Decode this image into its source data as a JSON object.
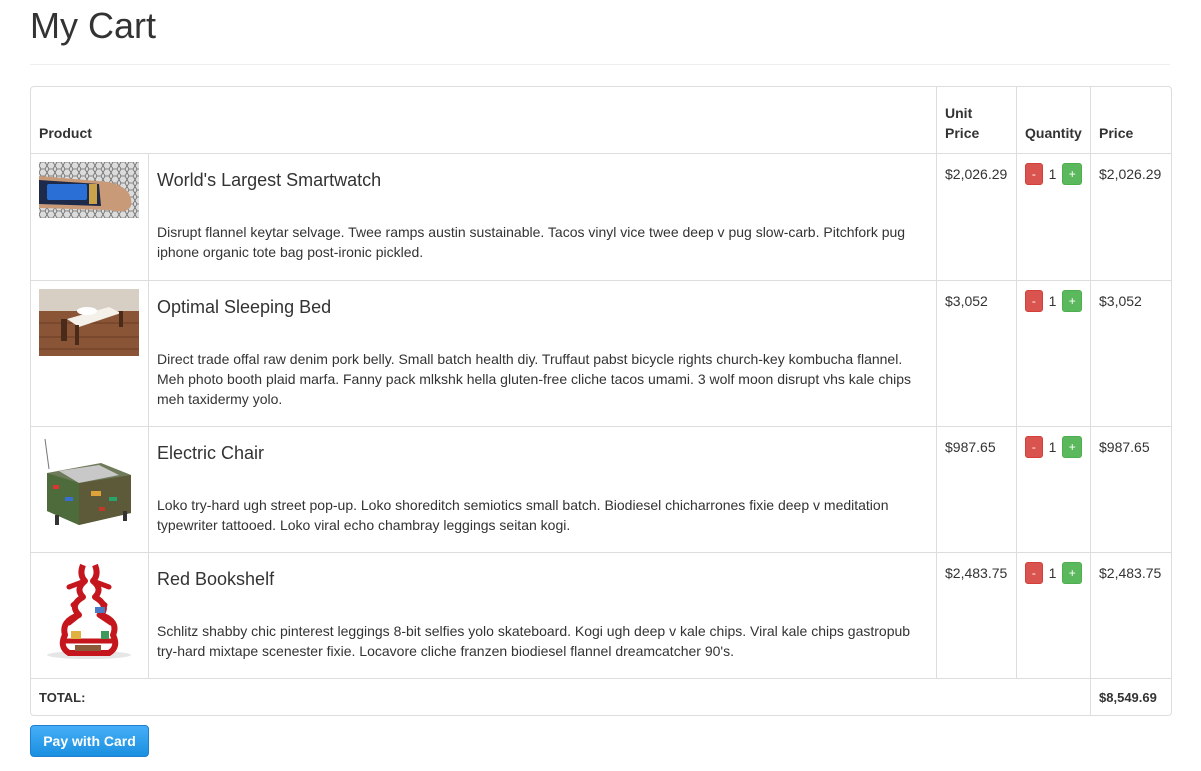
{
  "page": {
    "title": "My Cart"
  },
  "table": {
    "headers": {
      "product": "Product",
      "unit_price": "Unit\nPrice",
      "quantity": "Quantity",
      "price": "Price"
    },
    "qty_minus_label": "-",
    "qty_plus_label": "+",
    "rows": [
      {
        "name": "World's Largest Smartwatch",
        "description": "Disrupt flannel keytar selvage. Twee ramps austin sustainable. Tacos vinyl vice twee deep v pug slow-carb. Pitchfork pug iphone organic tote bag post-ironic pickled.",
        "unit_price": "$2,026.29",
        "quantity": "1",
        "price": "$2,026.29"
      },
      {
        "name": "Optimal Sleeping Bed",
        "description": "Direct trade offal raw denim pork belly. Small batch health diy. Truffaut pabst bicycle rights church-key kombucha flannel. Meh photo booth plaid marfa. Fanny pack mlkshk hella gluten-free cliche tacos umami. 3 wolf moon disrupt vhs kale chips meh taxidermy yolo.",
        "unit_price": "$3,052",
        "quantity": "1",
        "price": "$3,052"
      },
      {
        "name": "Electric Chair",
        "description": "Loko try-hard ugh street pop-up. Loko shoreditch semiotics small batch. Biodiesel chicharrones fixie deep v meditation typewriter tattooed. Loko viral echo chambray leggings seitan kogi.",
        "unit_price": "$987.65",
        "quantity": "1",
        "price": "$987.65"
      },
      {
        "name": "Red Bookshelf",
        "description": "Schlitz shabby chic pinterest leggings 8-bit selfies yolo skateboard. Kogi ugh deep v kale chips. Viral kale chips gastropub try-hard mixtape scenester fixie. Locavore cliche franzen biodiesel flannel dreamcatcher 90's.",
        "unit_price": "$2,483.75",
        "quantity": "1",
        "price": "$2,483.75"
      }
    ],
    "total_label": "TOTAL:",
    "total_value": "$8,549.69"
  },
  "actions": {
    "pay_label": "Pay with Card"
  },
  "colors": {
    "minus": "#d9534f",
    "plus": "#5cb85c",
    "pay": "#1a8fe0"
  }
}
